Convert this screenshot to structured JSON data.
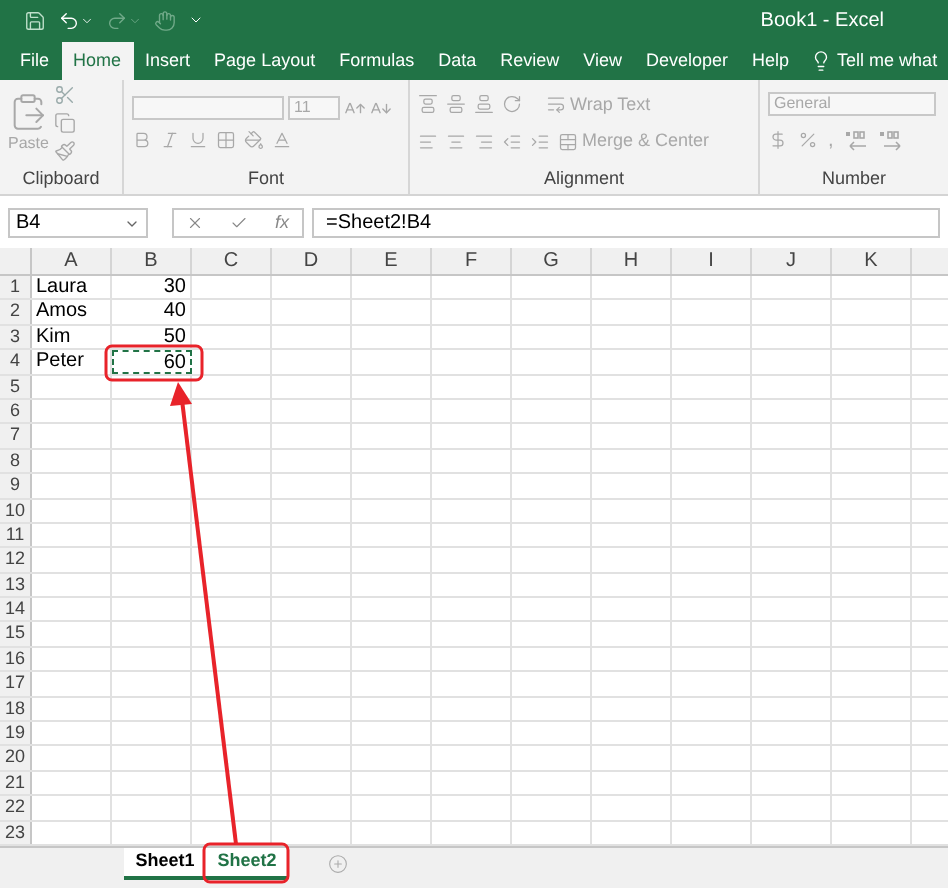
{
  "title_bar": {
    "title": "Book1  -  Excel"
  },
  "ribbon_tabs": [
    {
      "label": "File",
      "selected": false
    },
    {
      "label": "Home",
      "selected": true
    },
    {
      "label": "Insert",
      "selected": false
    },
    {
      "label": "Page Layout",
      "selected": false
    },
    {
      "label": "Formulas",
      "selected": false
    },
    {
      "label": "Data",
      "selected": false
    },
    {
      "label": "Review",
      "selected": false
    },
    {
      "label": "View",
      "selected": false
    },
    {
      "label": "Developer",
      "selected": false
    },
    {
      "label": "Help",
      "selected": false
    }
  ],
  "tell_me": {
    "placeholder": "Tell me what"
  },
  "ribbon": {
    "disabled": true,
    "clipboard": {
      "paste": "Paste",
      "label": "Clipboard"
    },
    "font": {
      "size": "11",
      "label": "Font"
    },
    "alignment": {
      "wrap_text": "Wrap Text",
      "merge": "Merge & Center",
      "label": "Alignment"
    },
    "number": {
      "format": "General",
      "comma": ",",
      "label": "Number"
    }
  },
  "formula_bar": {
    "name_box": "B4",
    "function_label": "fx",
    "formula": "=Sheet2!B4"
  },
  "columns": [
    "A",
    "B",
    "C",
    "D",
    "E",
    "F",
    "G",
    "H",
    "I",
    "J",
    "K"
  ],
  "rows": [
    {
      "header": "1",
      "cells": [
        {
          "kind": "text",
          "value": "Laura"
        },
        {
          "kind": "number",
          "value": "30",
          "copy_marquee": false
        }
      ]
    },
    {
      "header": "2",
      "cells": [
        {
          "kind": "text",
          "value": "Amos"
        },
        {
          "kind": "number",
          "value": "40",
          "copy_marquee": false
        }
      ]
    },
    {
      "header": "3",
      "cells": [
        {
          "kind": "text",
          "value": "Kim"
        },
        {
          "kind": "number",
          "value": "50",
          "copy_marquee": false
        }
      ]
    },
    {
      "header": "4",
      "cells": [
        {
          "kind": "text",
          "value": "Peter"
        },
        {
          "kind": "number",
          "value": "60",
          "copy_marquee": true
        }
      ]
    },
    {
      "header": "5"
    },
    {
      "header": "6"
    },
    {
      "header": "7"
    },
    {
      "header": "8"
    },
    {
      "header": "9"
    },
    {
      "header": "10"
    },
    {
      "header": "11"
    },
    {
      "header": "12"
    },
    {
      "header": "13"
    },
    {
      "header": "14"
    },
    {
      "header": "15"
    },
    {
      "header": "16"
    },
    {
      "header": "17"
    },
    {
      "header": "18"
    },
    {
      "header": "19"
    },
    {
      "header": "20"
    },
    {
      "header": "21"
    },
    {
      "header": "22"
    },
    {
      "header": "23"
    }
  ],
  "sheet_tabs": [
    {
      "label": "Sheet1",
      "selected": false
    },
    {
      "label": "Sheet2",
      "selected": true
    }
  ]
}
